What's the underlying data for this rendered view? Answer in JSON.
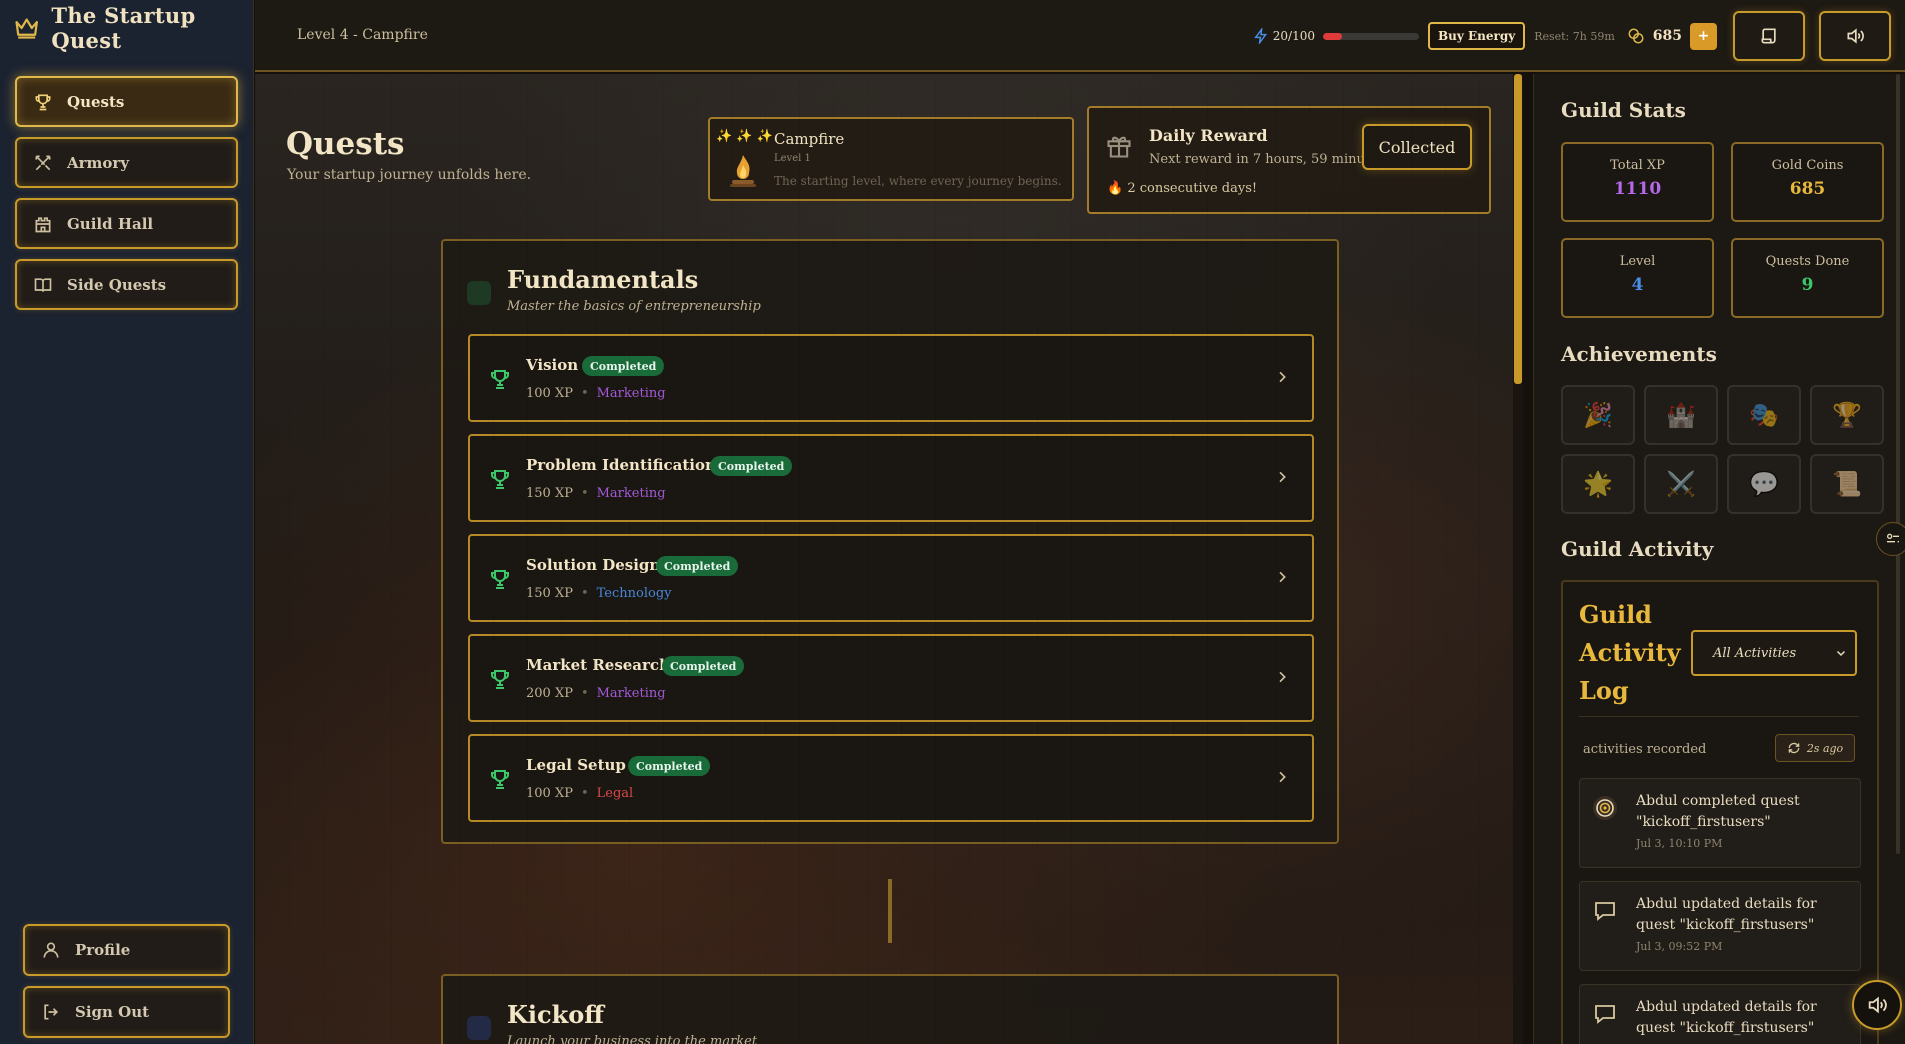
{
  "app": {
    "title": "The Startup Quest"
  },
  "sidebar": {
    "items": [
      {
        "label": "Quests",
        "icon": "trophy-icon",
        "active": true
      },
      {
        "label": "Armory",
        "icon": "swords-icon"
      },
      {
        "label": "Guild Hall",
        "icon": "castle-icon"
      },
      {
        "label": "Side Quests",
        "icon": "book-icon"
      }
    ],
    "bottom": [
      {
        "label": "Profile",
        "icon": "user-icon"
      },
      {
        "label": "Sign Out",
        "icon": "logout-icon"
      }
    ]
  },
  "topbar": {
    "level_label": "Level 4 - Campfire",
    "energy_text": "20/100",
    "energy_fraction": 0.2,
    "buy_energy": "Buy Energy",
    "reset": "Reset: 7h 59m",
    "coins": "685",
    "plus": "+",
    "colors": {
      "energy": "#e03a3a",
      "accent": "#c79a2a"
    }
  },
  "main": {
    "title": "Quests",
    "subtitle": "Your startup journey unfolds here.",
    "campfire": {
      "sparkles": "✨ ✨ ✨",
      "name": "Campfire",
      "level": "Level 1",
      "desc": "The starting level, where every journey begins."
    },
    "reward": {
      "title": "Daily Reward",
      "next": "Next reward in 7 hours, 59 minutes",
      "streak": "🔥 2 consecutive days!",
      "button": "Collected"
    },
    "sections": [
      {
        "title": "Fundamentals",
        "subtitle": "Master the basics of entrepreneurship",
        "quests": [
          {
            "name": "Vision Quest",
            "status": "Completed",
            "xp": "100 XP",
            "category": "Marketing"
          },
          {
            "name": "Problem Identification",
            "status": "Completed",
            "xp": "150 XP",
            "category": "Marketing"
          },
          {
            "name": "Solution Design",
            "status": "Completed",
            "xp": "150 XP",
            "category": "Technology"
          },
          {
            "name": "Market Research",
            "status": "Completed",
            "xp": "200 XP",
            "category": "Marketing"
          },
          {
            "name": "Legal Setup",
            "status": "Completed",
            "xp": "100 XP",
            "category": "Legal"
          }
        ]
      },
      {
        "title": "Kickoff",
        "subtitle": "Launch your business into the market"
      }
    ]
  },
  "guild": {
    "stats_title": "Guild Stats",
    "stats": [
      {
        "label": "Total XP",
        "value": "1110",
        "color": "#b469e8"
      },
      {
        "label": "Gold Coins",
        "value": "685",
        "color": "#e8b83c"
      },
      {
        "label": "Level",
        "value": "4",
        "color": "#4a8ee8"
      },
      {
        "label": "Quests Done",
        "value": "9",
        "color": "#3cc86a"
      }
    ],
    "achievements_title": "Achievements",
    "achievements": [
      "🎉",
      "🏰",
      "🎭",
      "🏆",
      "🌟",
      "⚔️",
      "💬",
      "📜"
    ],
    "activity_title": "Guild Activity",
    "log": {
      "title": "Guild Activity Log",
      "filter": "All Activities",
      "count": "activities recorded",
      "ago": "2s ago",
      "items": [
        {
          "icon": "target-icon",
          "text": "Abdul completed quest \"kickoff_firstusers\"",
          "time": "Jul 3, 10:10 PM"
        },
        {
          "icon": "chat-icon",
          "text": "Abdul updated details for quest \"kickoff_firstusers\"",
          "time": "Jul 3, 09:52 PM"
        },
        {
          "icon": "chat-icon",
          "text": "Abdul updated details for quest \"kickoff_firstusers\"",
          "time": ""
        }
      ]
    }
  }
}
